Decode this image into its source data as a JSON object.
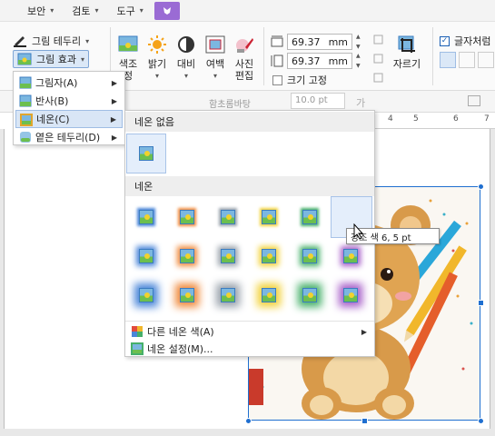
{
  "menubar": {
    "items": [
      {
        "label": "보안"
      },
      {
        "label": "검토"
      },
      {
        "label": "도구"
      }
    ]
  },
  "ribbon": {
    "picture_border_label": "그림 테두리",
    "picture_effect_label": "그림 효과",
    "color_label": "색조",
    "color_sub": "정",
    "brightness_label": "밝기",
    "contrast_label": "대비",
    "margin_label": "여백",
    "photo_edit_label_1": "사진",
    "photo_edit_label_2": "편집",
    "width_value": "69.37",
    "height_value": "69.37",
    "unit": "mm",
    "fix_size_label": "크기 고정",
    "crop_label": "자르기",
    "text_wrap_label": "글자처럼",
    "font_name": "함초롬바탕",
    "font_size": "10.0 pt",
    "font_sample": "가"
  },
  "ruler": {
    "ticks": [
      "4",
      "5",
      "6",
      "7"
    ]
  },
  "effect_menu": {
    "items": [
      {
        "label": "그림자(A)",
        "has_submenu": true
      },
      {
        "label": "반사(B)",
        "has_submenu": true
      },
      {
        "label": "네온(C)",
        "has_submenu": true,
        "selected": true
      },
      {
        "label": "옅은 테두리(D)",
        "has_submenu": true
      }
    ]
  },
  "neon_submenu": {
    "no_neon_header": "네온 없음",
    "neon_header": "네온",
    "other_color_label": "다른 네온 색(A)",
    "neon_settings_label": "네온 설정(M)...",
    "rows": [
      [
        "#4a86d9",
        "#f08a3c",
        "#9aa3ad",
        "#f2d23a",
        "#46b06a",
        "#a861c9"
      ],
      [
        "#4a86d9",
        "#f08a3c",
        "#9aa3ad",
        "#f2d23a",
        "#46b06a",
        "#a861c9"
      ],
      [
        "#4a86d9",
        "#f08a3c",
        "#9aa3ad",
        "#f2d23a",
        "#46b06a",
        "#a861c9"
      ]
    ]
  },
  "tooltip": {
    "text": "강조 색 6, 5 pt"
  },
  "colors": {
    "accent": "#1f6fd0",
    "menu_active": "#9a6bd4",
    "selection_bg": "#d9e6f6"
  }
}
